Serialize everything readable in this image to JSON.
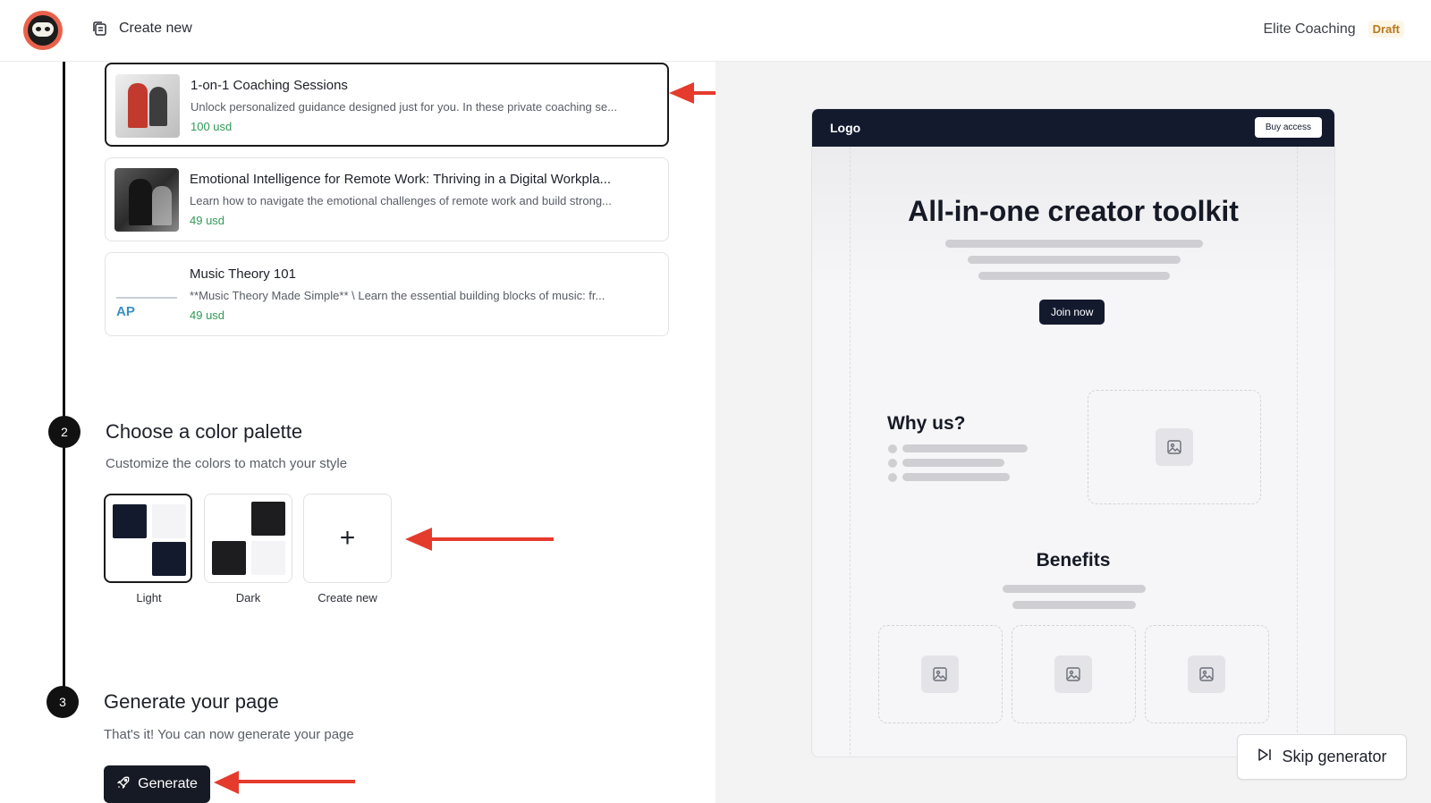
{
  "header": {
    "create_new_label": "Create new",
    "site_name": "Elite Coaching",
    "status_badge": "Draft"
  },
  "products": [
    {
      "title": "1-on-1 Coaching Sessions",
      "description": "Unlock personalized guidance designed just for you. In these private coaching se...",
      "price": "100 usd",
      "selected": true
    },
    {
      "title": "Emotional Intelligence for Remote Work: Thriving in a Digital Workpla...",
      "description": "Learn how to navigate the emotional challenges of remote work and build strong...",
      "price": "49 usd",
      "selected": false
    },
    {
      "title": "Music Theory 101",
      "description": "**Music Theory Made Simple** \\ Learn the essential building blocks of music: fr...",
      "price": "49 usd",
      "selected": false
    }
  ],
  "steps": {
    "palette": {
      "number": "2",
      "title": "Choose a color palette",
      "subtitle": "Customize the colors to match your style",
      "options": [
        {
          "label": "Light",
          "selected": true
        },
        {
          "label": "Dark",
          "selected": false
        },
        {
          "label": "Create new",
          "selected": false
        }
      ]
    },
    "generate": {
      "number": "3",
      "title": "Generate your page",
      "subtitle": "That's it! You can now generate your page",
      "button_label": "Generate"
    }
  },
  "preview": {
    "nav_logo": "Logo",
    "buy_button": "Buy access",
    "hero_title": "All-in-one creator toolkit",
    "join_button": "Join now",
    "why_title": "Why us?",
    "benefits_title": "Benefits"
  },
  "skip_button": "Skip generator",
  "colors": {
    "navy": "#141a2e",
    "dark": "#1d1d1f",
    "light_gray": "#f4f4f6",
    "price_green": "#2f9a56",
    "draft_orange": "#b7791f",
    "annotation_arrow": "#e53b2c"
  },
  "icons": {
    "app_logo": "sloth-logo-icon",
    "create_new": "copy-document-icon",
    "generate": "rocket-icon",
    "skip": "skip-forward-icon",
    "image_placeholder": "image-icon"
  }
}
